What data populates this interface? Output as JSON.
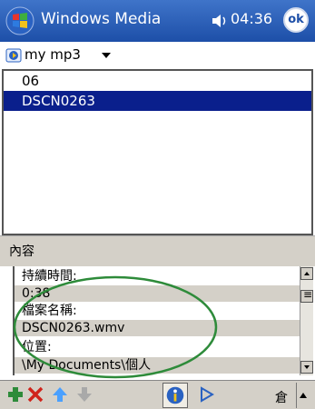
{
  "titlebar": {
    "title": "Windows Media",
    "clock": "04:36",
    "ok_label": "ok"
  },
  "playlist": {
    "name": "my mp3"
  },
  "list": {
    "items": [
      "06",
      "DSCN0263"
    ],
    "selected_index": 1
  },
  "section": {
    "label": "內容"
  },
  "details": {
    "rows": [
      "持續時間:",
      "0:38",
      "檔案名稱:",
      "DSCN0263.wmv",
      "位置:",
      "\\My Documents\\個人"
    ]
  },
  "toolbar": {
    "keyboard_label": "倉"
  },
  "colors": {
    "titlebar": "#1d4fa8",
    "selection": "#0a1f8c",
    "annotation": "#2e8b3a",
    "chrome": "#d4d0c8"
  }
}
